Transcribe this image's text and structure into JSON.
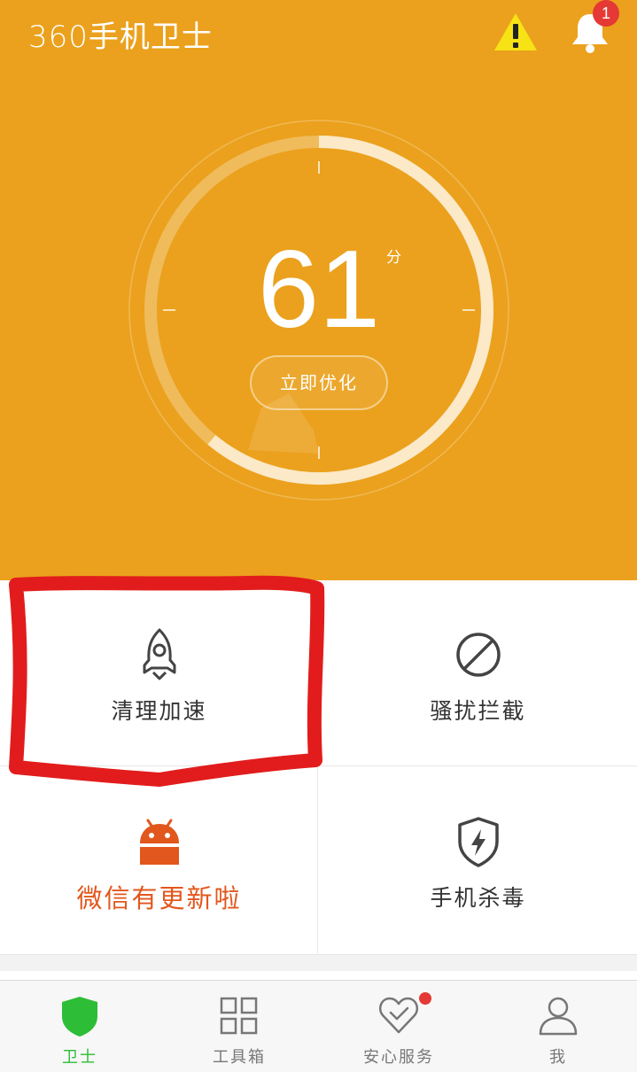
{
  "header": {
    "app_title": "360手机卫士",
    "bell_badge": "1",
    "bg_color": "#eba11d"
  },
  "gauge": {
    "score": "61",
    "score_unit": "分",
    "score_fraction": 0.61,
    "optimize_label": "立即优化"
  },
  "features": [
    {
      "label": "清理加速",
      "icon": "rocket-icon"
    },
    {
      "label": "骚扰拦截",
      "icon": "block-icon"
    },
    {
      "label": "微信有更新啦",
      "icon": "android-icon",
      "color": "#e2571d"
    },
    {
      "label": "手机杀毒",
      "icon": "shield-bolt-icon"
    }
  ],
  "tabs": [
    {
      "label": "卫士",
      "icon": "shield-icon",
      "active": true
    },
    {
      "label": "工具箱",
      "icon": "grid-icon"
    },
    {
      "label": "安心服务",
      "icon": "heart-check-icon"
    },
    {
      "label": "我",
      "icon": "user-icon"
    }
  ],
  "colors": {
    "accent_green": "#2ebd36",
    "highlight_red": "#e21c1c",
    "badge_red": "#e53935"
  }
}
